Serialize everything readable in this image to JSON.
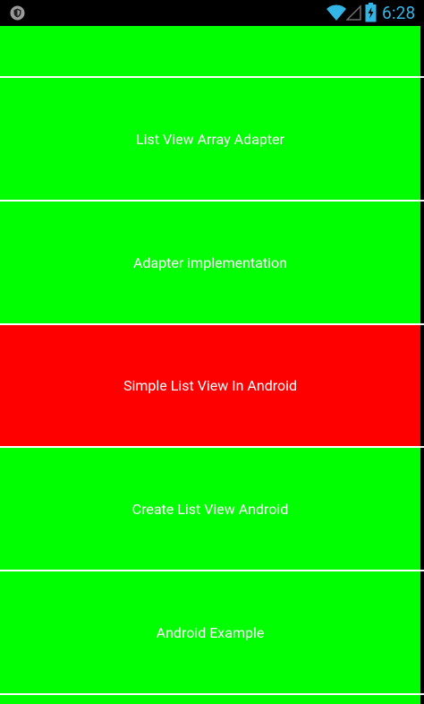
{
  "status_bar": {
    "time": "6:28",
    "icons": [
      "shield-icon",
      "wifi-icon",
      "signal-icon",
      "battery-charging-icon"
    ]
  },
  "colors": {
    "item_default": "#00ff00",
    "item_selected": "#ff0000",
    "text": "#ffffff",
    "status_accent": "#33b5e5"
  },
  "list": {
    "items": [
      {
        "label": ""
      },
      {
        "label": "List View Array Adapter"
      },
      {
        "label": "Adapter implementation"
      },
      {
        "label": "Simple List View In Android",
        "selected": true
      },
      {
        "label": "Create List View Android"
      },
      {
        "label": "Android Example"
      }
    ]
  }
}
